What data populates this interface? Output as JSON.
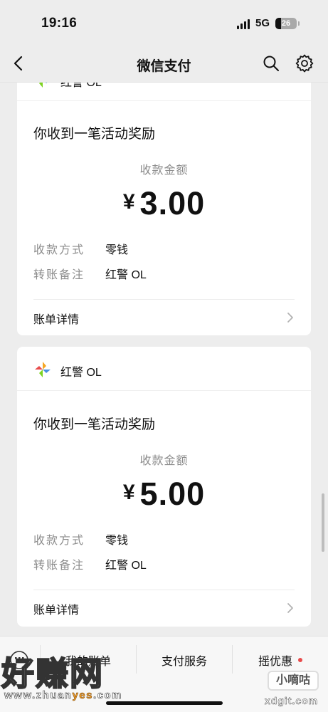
{
  "status_bar": {
    "time": "19:16",
    "network": "5G",
    "battery": "26"
  },
  "nav": {
    "title": "微信支付",
    "back_icon": "back-arrow-icon",
    "search_icon": "search-icon",
    "settings_icon": "gear-icon"
  },
  "cards": [
    {
      "app_name": "红警 OL",
      "title": "你收到一笔活动奖励",
      "amount_label": "收款金额",
      "currency": "¥",
      "amount": "3.00",
      "rows": [
        {
          "label": "收款方式",
          "value": "零钱"
        },
        {
          "label": "转账备注",
          "value": "红警 OL"
        }
      ],
      "detail_label": "账单详情"
    },
    {
      "app_name": "红警 OL",
      "title": "你收到一笔活动奖励",
      "amount_label": "收款金额",
      "currency": "¥",
      "amount": "5.00",
      "rows": [
        {
          "label": "收款方式",
          "value": "零钱"
        },
        {
          "label": "转账备注",
          "value": "红警 OL"
        }
      ],
      "detail_label": "账单详情"
    }
  ],
  "bottom_bar": {
    "items": [
      {
        "label": "我的账单"
      },
      {
        "label": "支付服务"
      },
      {
        "label": "摇优惠"
      }
    ],
    "keyboard_icon": "keyboard-icon"
  },
  "watermarks": {
    "left_logo": "好赚网",
    "left_url_pre": "www.zhuan",
    "left_url_hl": "yes",
    "left_url_post": ".com",
    "right_badge": "小嘀咕",
    "right_site": "xdgit.com"
  },
  "colors": {
    "background": "#ededed",
    "card": "#ffffff",
    "label_gray": "#8c8c8c",
    "notify_red": "#e84b4b",
    "accent_orange": "#f59f2a"
  }
}
